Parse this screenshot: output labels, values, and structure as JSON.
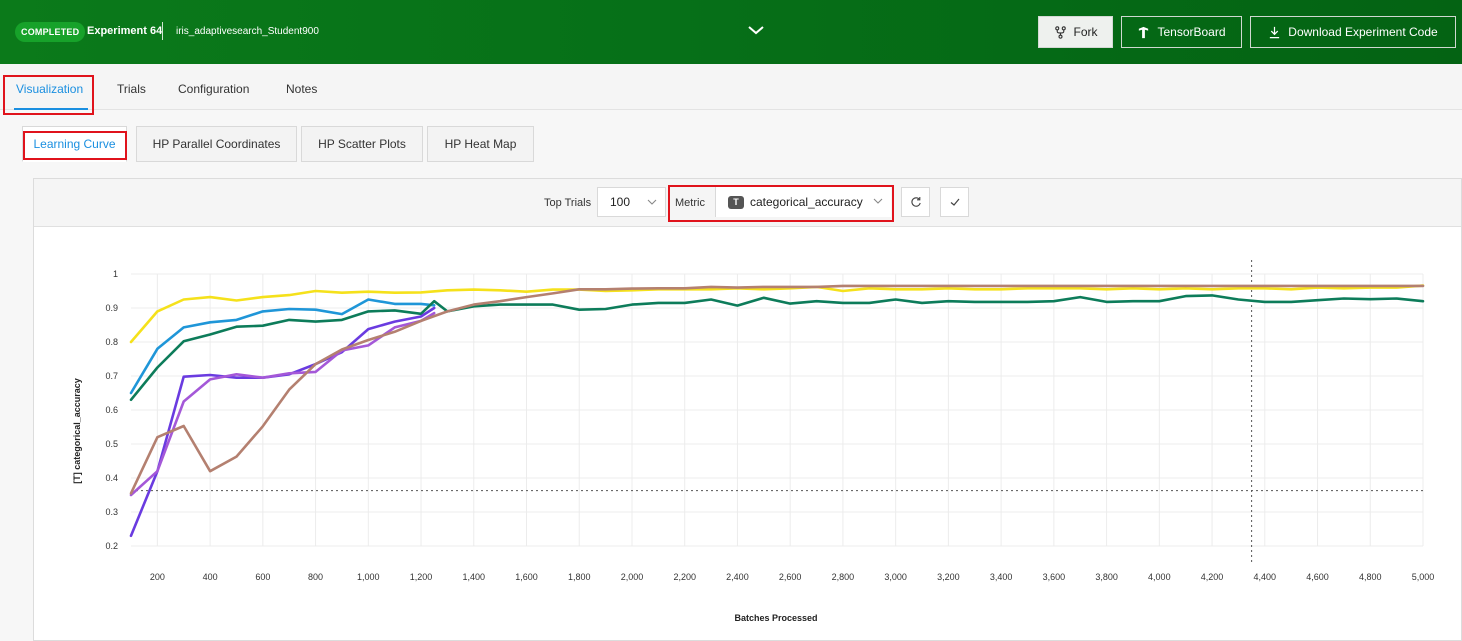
{
  "header": {
    "status_badge": "COMPLETED",
    "experiment_title": "Experiment 64",
    "experiment_description": "iris_adaptivesearch_Student900",
    "fork_label": "Fork",
    "tensorboard_label": "TensorBoard",
    "download_label": "Download Experiment Code"
  },
  "tabs": [
    "Visualization",
    "Trials",
    "Configuration",
    "Notes"
  ],
  "subtabs": [
    "Learning Curve",
    "HP Parallel Coordinates",
    "HP Scatter Plots",
    "HP Heat Map"
  ],
  "toolbar": {
    "top_trials_label": "Top Trials",
    "top_trials_value": "100",
    "metric_label": "Metric",
    "metric_badge": "T",
    "metric_value": "categorical_accuracy"
  },
  "colors": {
    "header": "#067018",
    "accent": "#1a8fe0",
    "highlight": "#e0131c"
  },
  "chart_data": {
    "type": "line",
    "xlabel": "Batches Processed",
    "ylabel": "[T] categorical_accuracy",
    "xlim": [
      100,
      5000
    ],
    "ylim": [
      0.2,
      1.0
    ],
    "x_ticks": [
      200,
      400,
      600,
      800,
      1000,
      1200,
      1400,
      1600,
      1800,
      2000,
      2200,
      2400,
      2600,
      2800,
      3000,
      3200,
      3400,
      3600,
      3800,
      4000,
      4200,
      4400,
      4600,
      4800,
      5000
    ],
    "x_tick_labels": [
      "200",
      "400",
      "600",
      "800",
      "1,000",
      "1,200",
      "1,400",
      "1,600",
      "1,800",
      "2,000",
      "2,200",
      "2,400",
      "2,600",
      "2,800",
      "3,000",
      "3,200",
      "3,400",
      "3,600",
      "3,800",
      "4,000",
      "4,200",
      "4,400",
      "4,600",
      "4,800",
      "5,000"
    ],
    "y_ticks": [
      0.2,
      0.3,
      0.4,
      0.5,
      0.6,
      0.7,
      0.8,
      0.9,
      1
    ],
    "y_tick_labels": [
      "0.2",
      "0.3",
      "0.4",
      "0.5",
      "0.6",
      "0.7",
      "0.8",
      "0.9",
      "1"
    ],
    "grid": true,
    "crosshair": {
      "x": 4350,
      "y": 0.363
    },
    "series": [
      {
        "color": "#f5e11b",
        "x": [
          100,
          200,
          300,
          400,
          500,
          600,
          700,
          800,
          900,
          1000,
          1100,
          1200,
          1300,
          1400,
          1500,
          1600,
          1700,
          1800,
          1900,
          2000,
          2100,
          2200,
          2300,
          2400,
          2500,
          2600,
          2700,
          2800,
          2900,
          3000,
          3100,
          3200,
          3300,
          3400,
          3500,
          3600,
          3700,
          3800,
          3900,
          4000,
          4100,
          4200,
          4300,
          4400,
          4500,
          4600,
          4700,
          4800,
          4900,
          5000
        ],
        "y": [
          0.8,
          0.89,
          0.925,
          0.932,
          0.922,
          0.932,
          0.938,
          0.95,
          0.945,
          0.948,
          0.945,
          0.946,
          0.952,
          0.954,
          0.952,
          0.948,
          0.954,
          0.954,
          0.95,
          0.952,
          0.955,
          0.955,
          0.955,
          0.958,
          0.955,
          0.958,
          0.962,
          0.95,
          0.958,
          0.955,
          0.955,
          0.958,
          0.955,
          0.955,
          0.958,
          0.958,
          0.958,
          0.955,
          0.958,
          0.955,
          0.958,
          0.955,
          0.958,
          0.958,
          0.955,
          0.96,
          0.958,
          0.96,
          0.96,
          0.966
        ]
      },
      {
        "color": "#1f96d8",
        "x": [
          100,
          200,
          300,
          400,
          500,
          600,
          700,
          800,
          900,
          1000,
          1100,
          1200,
          1250
        ],
        "y": [
          0.65,
          0.78,
          0.843,
          0.858,
          0.865,
          0.89,
          0.897,
          0.895,
          0.882,
          0.925,
          0.912,
          0.912,
          0.908
        ]
      },
      {
        "color": "#0d7c5a",
        "x": [
          100,
          200,
          300,
          400,
          500,
          600,
          700,
          800,
          900,
          1000,
          1100,
          1200,
          1250,
          1300,
          1400,
          1500,
          1600,
          1700,
          1800,
          1900,
          2000,
          2100,
          2200,
          2300,
          2400,
          2500,
          2600,
          2700,
          2800,
          2900,
          3000,
          3100,
          3200,
          3300,
          3400,
          3500,
          3600,
          3700,
          3800,
          3900,
          4000,
          4100,
          4200,
          4300,
          4400,
          4500,
          4600,
          4700,
          4800,
          4900,
          5000
        ],
        "y": [
          0.63,
          0.725,
          0.802,
          0.822,
          0.845,
          0.848,
          0.865,
          0.86,
          0.865,
          0.89,
          0.893,
          0.883,
          0.92,
          0.89,
          0.905,
          0.91,
          0.91,
          0.91,
          0.895,
          0.897,
          0.91,
          0.915,
          0.915,
          0.925,
          0.907,
          0.93,
          0.913,
          0.92,
          0.915,
          0.915,
          0.925,
          0.915,
          0.92,
          0.918,
          0.918,
          0.918,
          0.92,
          0.932,
          0.918,
          0.92,
          0.92,
          0.935,
          0.937,
          0.925,
          0.918,
          0.918,
          0.923,
          0.928,
          0.926,
          0.928,
          0.92
        ]
      },
      {
        "color": "#6a3be0",
        "x": [
          100,
          200,
          300,
          400,
          500,
          600,
          700,
          800,
          900,
          1000,
          1100,
          1200,
          1250
        ],
        "y": [
          0.23,
          0.42,
          0.698,
          0.703,
          0.695,
          0.695,
          0.705,
          0.735,
          0.77,
          0.838,
          0.86,
          0.875,
          0.9
        ]
      },
      {
        "color": "#a458d8",
        "x": [
          100,
          200,
          300,
          400,
          500,
          600,
          700,
          800,
          900,
          1000,
          1100,
          1200,
          1250
        ],
        "y": [
          0.35,
          0.42,
          0.625,
          0.69,
          0.705,
          0.695,
          0.708,
          0.712,
          0.775,
          0.79,
          0.843,
          0.862,
          0.885
        ]
      },
      {
        "color": "#b48070",
        "x": [
          100,
          200,
          300,
          400,
          500,
          600,
          700,
          800,
          900,
          1000,
          1100,
          1200,
          1300,
          1400,
          1500,
          1600,
          1700,
          1800,
          1900,
          2000,
          2100,
          2200,
          2300,
          2400,
          2500,
          2600,
          2700,
          2800,
          2900,
          3000,
          3100,
          3200,
          3300,
          3400,
          3500,
          3600,
          3700,
          3800,
          3900,
          4000,
          4100,
          4200,
          4300,
          4400,
          4500,
          4600,
          4700,
          4800,
          4900,
          5000
        ],
        "y": [
          0.355,
          0.52,
          0.553,
          0.42,
          0.463,
          0.552,
          0.66,
          0.735,
          0.778,
          0.806,
          0.83,
          0.862,
          0.89,
          0.91,
          0.92,
          0.932,
          0.943,
          0.955,
          0.955,
          0.957,
          0.958,
          0.958,
          0.962,
          0.96,
          0.962,
          0.962,
          0.962,
          0.965,
          0.965,
          0.965,
          0.965,
          0.965,
          0.965,
          0.965,
          0.965,
          0.965,
          0.965,
          0.965,
          0.965,
          0.965,
          0.965,
          0.965,
          0.965,
          0.965,
          0.965,
          0.965,
          0.965,
          0.965,
          0.965,
          0.965
        ]
      }
    ]
  }
}
